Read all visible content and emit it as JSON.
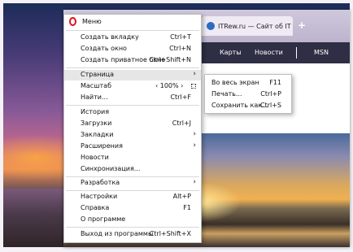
{
  "browser": {
    "tab_title": "ITRew.ru — Сайт об IT для",
    "new_tab": "+",
    "site_nav": [
      "Карты",
      "Новости",
      "MSN"
    ]
  },
  "menu": {
    "title": "Меню",
    "items": [
      {
        "label": "Создать вкладку",
        "shortcut": "Ctrl+T"
      },
      {
        "label": "Создать окно",
        "shortcut": "Ctrl+N"
      },
      {
        "label": "Создать приватное окно",
        "shortcut": "Ctrl+Shift+N"
      },
      {
        "label": "Страница",
        "shortcut": ""
      },
      {
        "label": "Масштаб",
        "shortcut": ""
      },
      {
        "label": "Найти...",
        "shortcut": "Ctrl+F"
      },
      {
        "label": "История",
        "shortcut": ""
      },
      {
        "label": "Загрузки",
        "shortcut": "Ctrl+J"
      },
      {
        "label": "Закладки",
        "shortcut": ""
      },
      {
        "label": "Расширения",
        "shortcut": ""
      },
      {
        "label": "Новости",
        "shortcut": ""
      },
      {
        "label": "Синхронизация...",
        "shortcut": ""
      },
      {
        "label": "Разработка",
        "shortcut": ""
      },
      {
        "label": "Настройки",
        "shortcut": "Alt+P"
      },
      {
        "label": "Справка",
        "shortcut": "F1"
      },
      {
        "label": "О программе",
        "shortcut": ""
      },
      {
        "label": "Выход из программы",
        "shortcut": "Ctrl+Shift+X"
      }
    ],
    "zoom_value": "‹ 100% ›"
  },
  "submenu": {
    "items": [
      {
        "label": "Во весь экран",
        "shortcut": "F11"
      },
      {
        "label": "Печать...",
        "shortcut": "Ctrl+P"
      },
      {
        "label": "Сохранить как...",
        "shortcut": "Ctrl+S"
      }
    ]
  },
  "icons": {
    "opera": "opera-logo-icon",
    "submenu_arrow": "chevron-right-icon",
    "fullscreen": "fullscreen-icon",
    "tab_favicon": "favicon-icon"
  },
  "colors": {
    "opera_red": "#e0141e",
    "highlight": "#e6e6e6",
    "site_nav_bg": "#2e2e44"
  }
}
